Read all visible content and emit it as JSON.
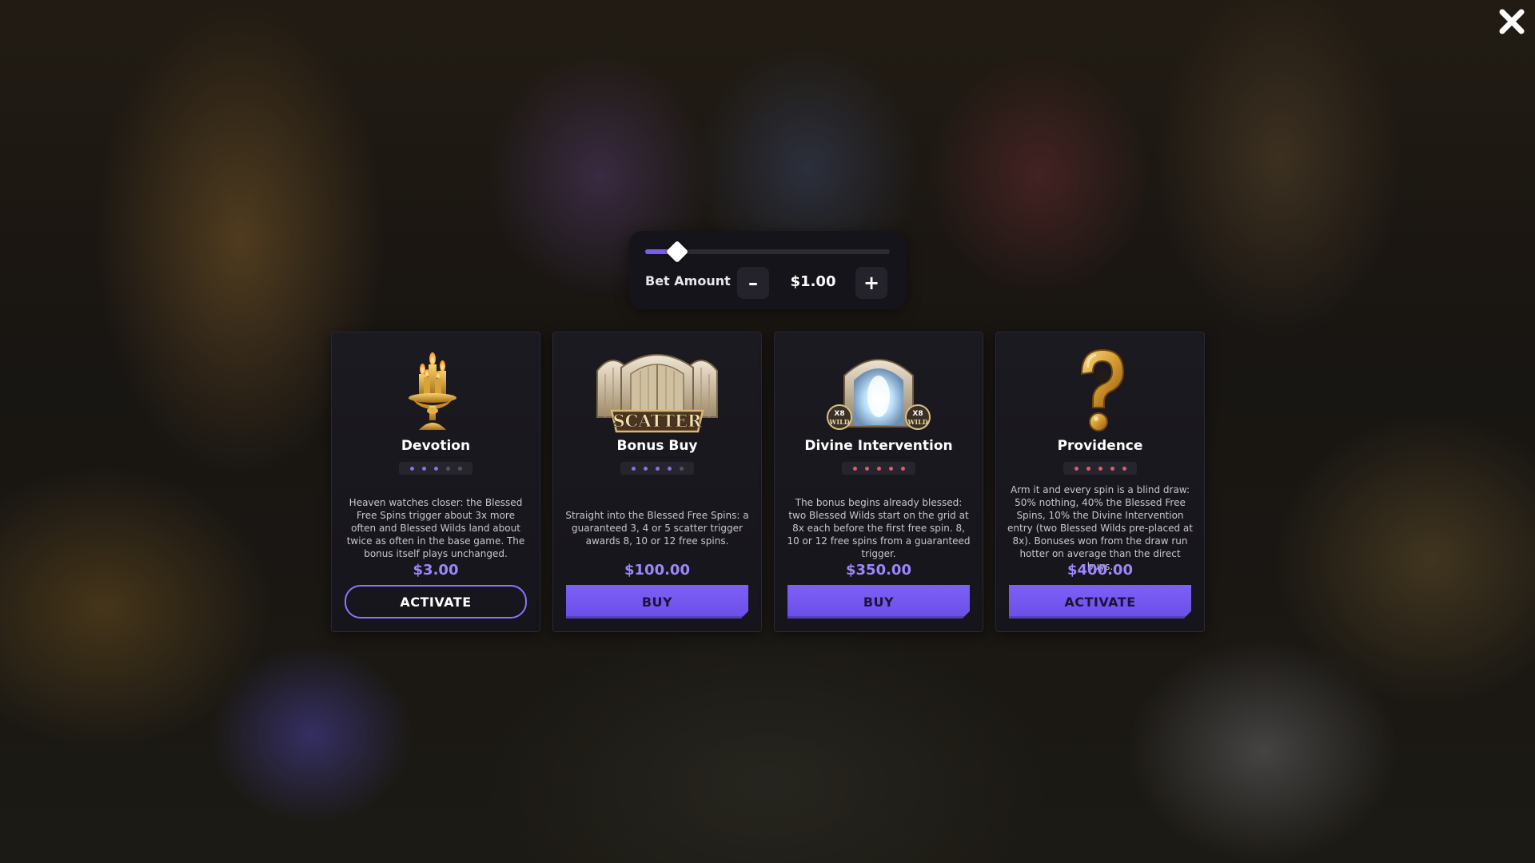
{
  "close": {
    "icon": "close-icon"
  },
  "bet": {
    "label": "Bet Amount",
    "value": "$1.00",
    "minus_label": "–",
    "plus_label": "+",
    "slider_level": 0.13
  },
  "colors": {
    "accent": "#7b5cf2",
    "price": "#9d86ff",
    "rating_on_purple": "#8c6cf5",
    "rating_on_red": "#e35a6a",
    "rating_off": "#55545c"
  },
  "cards": [
    {
      "title": "Devotion",
      "icon": "candelabra-icon",
      "rating": {
        "filled": 3,
        "total": 5,
        "color": "purple"
      },
      "description": "Heaven watches closer: the Blessed Free Spins trigger about 3x more often and Blessed Wilds land about twice as often in the base game. The bonus itself plays unchanged.",
      "price": "$3.00",
      "button": "ACTIVATE",
      "button_style": "outline"
    },
    {
      "title": "Bonus Buy",
      "icon": "scatter-gates-icon",
      "scatter_text": "SCATTER",
      "rating": {
        "filled": 4,
        "total": 5,
        "color": "purple"
      },
      "description": "Straight into the Blessed Free Spins: a guaranteed 3, 4 or 5 scatter trigger awards 8, 10 or 12 free spins.",
      "price": "$100.00",
      "button": "BUY",
      "button_style": "solid"
    },
    {
      "title": "Divine Intervention",
      "icon": "portal-wild-icon",
      "wild_badges": [
        "X8",
        "WILD"
      ],
      "rating": {
        "filled": 5,
        "total": 5,
        "color": "red"
      },
      "description": "The bonus begins already blessed: two Blessed Wilds start on the grid at 8x each before the first free spin. 8, 10 or 12 free spins from a guaranteed trigger.",
      "price": "$350.00",
      "button": "BUY",
      "button_style": "solid"
    },
    {
      "title": "Providence",
      "icon": "question-mark-icon",
      "rating": {
        "filled": 5,
        "total": 5,
        "color": "red"
      },
      "description": "Arm it and every spin is a blind draw: 50% nothing, 40% the Blessed Free Spins, 10% the Divine Intervention entry (two Blessed Wilds pre-placed at 8x). Bonuses won from the draw run hotter on average than the direct buys.",
      "price": "$400.00",
      "button": "ACTIVATE",
      "button_style": "solid"
    }
  ]
}
